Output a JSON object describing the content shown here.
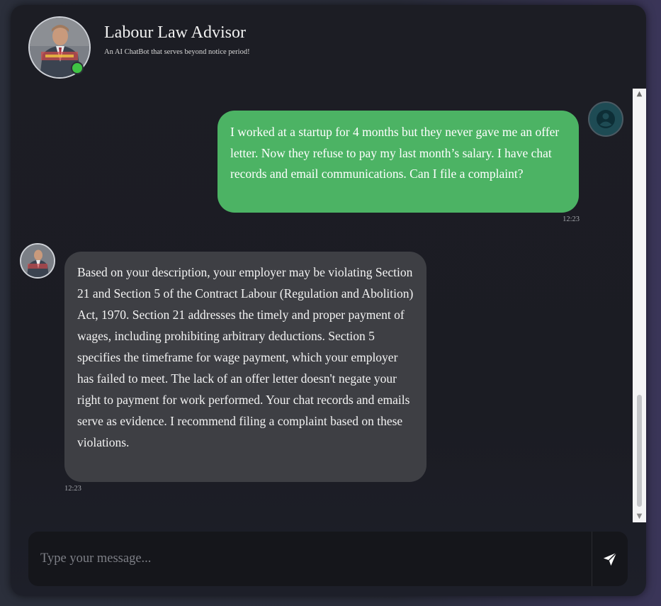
{
  "header": {
    "title": "Labour Law Advisor",
    "subtitle": "An AI ChatBot that serves beyond notice period!",
    "avatar_icon": "bot-portrait-photo",
    "status": "online",
    "status_color": "#3fc444"
  },
  "messages": [
    {
      "sender": "user",
      "avatar_icon": "user-circle-icon",
      "text": "I worked at a startup for 4 months but they never gave me an offer letter. Now they refuse to pay my last month’s salary. I have chat records and email communications. Can I file a complaint?",
      "time": "12:23",
      "bubble_color": "#4cb364"
    },
    {
      "sender": "bot",
      "avatar_icon": "bot-portrait-photo",
      "text": "Based on your description, your employer may be violating Section 21 and Section 5 of the Contract Labour (Regulation and Abolition) Act, 1970. Section 21 addresses the timely and proper payment of wages, including prohibiting arbitrary deductions. Section 5 specifies the timeframe for wage payment, which your employer has failed to meet. The lack of an offer letter doesn't negate your right to payment for work performed. Your chat records and emails serve as evidence. I recommend filing a complaint based on these violations.",
      "time": "12:23",
      "bubble_color": "#3e3f44"
    }
  ],
  "scrollbar": {
    "up_icon": "▲",
    "down_icon": "▼"
  },
  "composer": {
    "placeholder": "Type your message...",
    "value": "",
    "send_icon": "paper-plane-icon"
  }
}
